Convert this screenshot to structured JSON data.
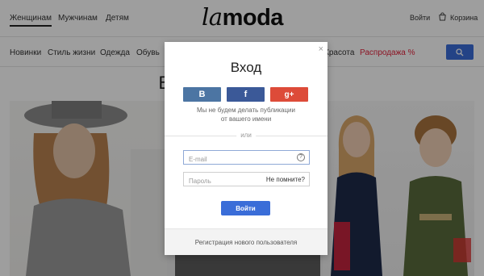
{
  "header": {
    "gender_tabs": [
      {
        "label": "Женщинам",
        "active": true
      },
      {
        "label": "Мужчинам",
        "active": false
      },
      {
        "label": "Детям",
        "active": false
      }
    ],
    "logo": {
      "part1": "la",
      "part2": "moda"
    },
    "login_link": "Войти",
    "cart_label": "Корзина"
  },
  "categories": [
    "Новинки",
    "Стиль жизни",
    "Одежда",
    "Обувь",
    "Красота",
    "Распродажа %"
  ],
  "page_heading": "Выберите … раздел",
  "modal": {
    "close": "×",
    "title": "Вход",
    "social": {
      "vk": "B",
      "facebook": "f",
      "google": "g+"
    },
    "social_note_line1": "Мы не будем делать публикации",
    "social_note_line2": "от вашего имени",
    "divider": "или",
    "email_placeholder": "E-mail",
    "help": "?",
    "password_placeholder": "Пароль",
    "forgot": "Не помните?",
    "submit": "Войти",
    "register": "Регистрация нового пользователя"
  },
  "colors": {
    "accent": "#3a6dd8",
    "sale": "#e2233c",
    "vk": "#4c75a3",
    "facebook": "#3b5998",
    "google": "#dd4b39"
  }
}
